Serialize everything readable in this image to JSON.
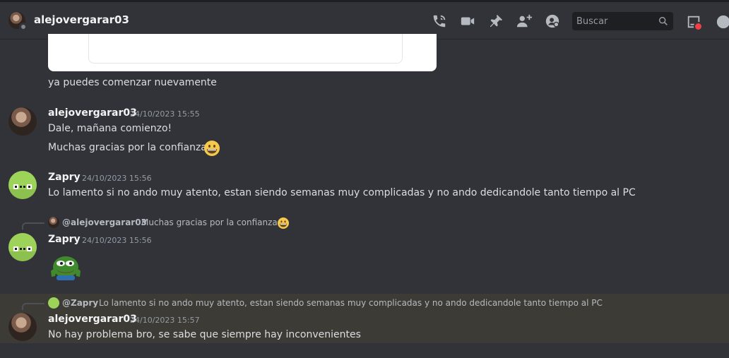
{
  "header": {
    "title": "alejovergarar03",
    "search_placeholder": "Buscar",
    "icons": [
      "call-icon",
      "video-icon",
      "pin-icon",
      "add-friend-icon",
      "profile-icon",
      "search-icon",
      "inbox-icon"
    ]
  },
  "colors": {
    "background": "#313338",
    "highlight": "#3d3b35",
    "accent_red": "#f23f43",
    "zapry_green": "#9ed35a"
  },
  "messages": {
    "prev_text": "ya puedes comenzar nuevamente",
    "m1": {
      "author": "alejovergarar03",
      "time": "24/10/2023 15:55",
      "line1": "Dale, mañana comienzo!",
      "line2": "Muchas gracias por la confianza"
    },
    "m2": {
      "author": "Zapry",
      "time": "24/10/2023 15:56",
      "text": "Lo lamento si no ando muy atento, estan siendo semanas muy complicadas y no ando dedicandole tanto tiempo al PC"
    },
    "m3": {
      "reply_author": "@alejovergarar03",
      "reply_text": "Muchas gracias por la confianza",
      "author": "Zapry",
      "time": "24/10/2023 15:56",
      "sticker": "pepe-emoji"
    },
    "m4": {
      "reply_author": "@Zapry",
      "reply_text": "Lo lamento si no ando muy atento, estan siendo semanas muy complicadas y no ando dedicandole tanto tiempo al PC",
      "author": "alejovergarar03",
      "time": "24/10/2023 15:57",
      "text": "No hay problema bro, se sabe que siempre hay inconvenientes"
    }
  }
}
